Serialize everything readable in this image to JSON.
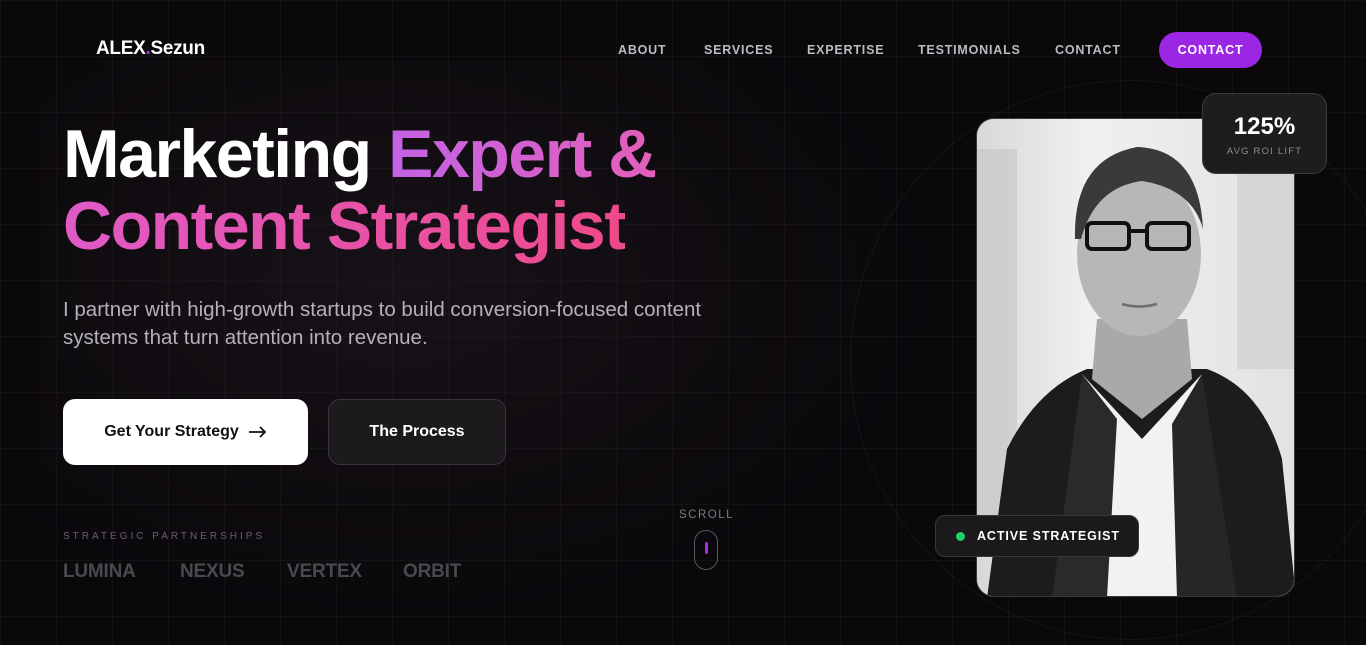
{
  "brand": {
    "name": "ALEX",
    "dot": ".",
    "suffix": "Sezun"
  },
  "nav": {
    "items": [
      "ABOUT",
      "SERVICES",
      "EXPERTISE",
      "TESTIMONIALS",
      "CONTACT"
    ],
    "cta": "CONTACT"
  },
  "hero": {
    "title_plain": "Marketing",
    "title_grad1": "Expert &",
    "title_grad2": "Content Strategist",
    "subtitle": "I partner with high-growth startups to build conversion-focused content systems that turn attention into revenue.",
    "primary_button": "Get Your Strategy",
    "primary_button_icon": "arrow-right-icon",
    "secondary_button": "The Process"
  },
  "partners": {
    "label": "STRATEGIC PARTNERSHIPS",
    "names": [
      "LUMINA",
      "NEXUS",
      "VERTEX",
      "ORBIT"
    ]
  },
  "scroll": {
    "label": "SCROLL"
  },
  "portrait": {
    "stat_value": "125%",
    "stat_label": "AVG ROI LIFT",
    "badge": "ACTIVE STRATEGIST",
    "status_color": "#1fcf6a"
  },
  "colors": {
    "accent": "#9b26e4",
    "gradient_start": "#c362e6",
    "gradient_end": "#ee4a8a",
    "background": "#0a080b"
  }
}
